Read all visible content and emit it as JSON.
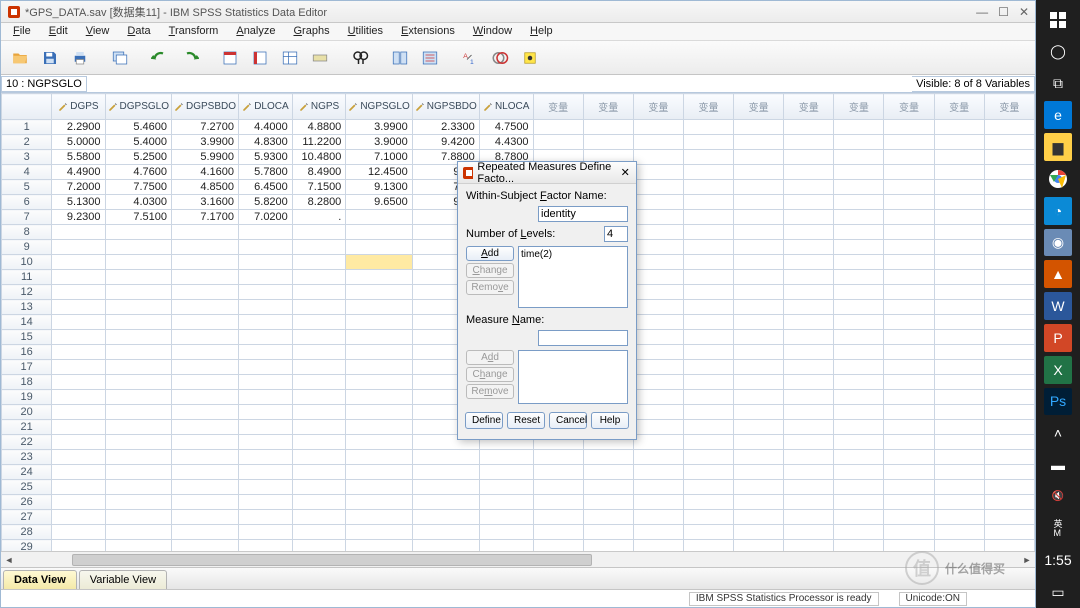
{
  "title": "*GPS_DATA.sav [数据集11] - IBM SPSS Statistics Data Editor",
  "menus": [
    "File",
    "Edit",
    "View",
    "Data",
    "Transform",
    "Analyze",
    "Graphs",
    "Utilities",
    "Extensions",
    "Window",
    "Help"
  ],
  "address_cell": "10 : NGPSGLO",
  "visible_label": "Visible: 8 of 8 Variables",
  "columns": [
    "DGPS",
    "DGPSGLO",
    "DGPSBDO",
    "DLOCA",
    "NGPS",
    "NGPSGLO",
    "NGPSBDO",
    "NLOCA"
  ],
  "empty_col_label": "变量",
  "rows": [
    [
      "2.2900",
      "5.4600",
      "7.2700",
      "4.4000",
      "4.8800",
      "3.9900",
      "2.3300",
      "4.7500"
    ],
    [
      "5.0000",
      "5.4000",
      "3.9900",
      "4.8300",
      "11.2200",
      "3.9000",
      "9.4200",
      "4.4300"
    ],
    [
      "5.5800",
      "5.2500",
      "5.9900",
      "5.9300",
      "10.4800",
      "7.1000",
      "7.8800",
      "8.7800"
    ],
    [
      "4.4900",
      "4.7600",
      "4.1600",
      "5.7800",
      "8.4900",
      "12.4500",
      "9.38",
      ""
    ],
    [
      "7.2000",
      "7.7500",
      "4.8500",
      "6.4500",
      "7.1500",
      "9.1300",
      "7.33",
      ""
    ],
    [
      "5.1300",
      "4.0300",
      "3.1600",
      "5.8200",
      "8.2800",
      "9.6500",
      "9.76",
      ""
    ],
    [
      "9.2300",
      "7.5100",
      "7.1700",
      "7.0200",
      ".",
      "",
      "",
      ""
    ]
  ],
  "total_rows": 29,
  "selected_cell": {
    "row": 10,
    "col": 6
  },
  "tabs": {
    "data": "Data View",
    "variable": "Variable View"
  },
  "status": {
    "proc": "IBM SPSS Statistics Processor is ready",
    "unicode": "Unicode:ON"
  },
  "dialog": {
    "title": "Repeated Measures Define Facto...",
    "factor_label_pre": "Within-Subject ",
    "factor_label_key": "F",
    "factor_label_post": "actor Name:",
    "factor_value": "identity",
    "levels_label_pre": "Number of ",
    "levels_label_key": "L",
    "levels_label_post": "evels:",
    "levels_value": "4",
    "factor_list": "time(2)",
    "add": "Add",
    "change": "Change",
    "remove": "Remove",
    "measure_label_pre": "Measure ",
    "measure_label_key": "N",
    "measure_label_post": "ame:",
    "measure_value": "",
    "define": "Define",
    "reset": "Reset",
    "cancel": "Cancel",
    "help": "Help"
  },
  "winbar_time": "1:55",
  "watermark": "什么值得买"
}
